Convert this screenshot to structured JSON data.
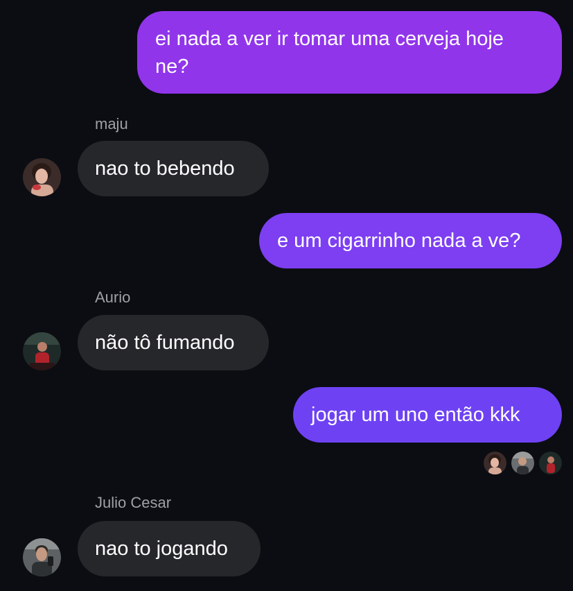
{
  "messages": [
    {
      "direction": "sent",
      "text": "ei nada a ver ir tomar uma cerveja hoje ne?",
      "color": "#9135eb"
    },
    {
      "direction": "received",
      "sender": "maju",
      "text": "nao to bebendo",
      "avatar_icon": "user-avatar-photo"
    },
    {
      "direction": "sent",
      "text": "e um cigarrinho nada a ve?",
      "color": "#7d3ff1"
    },
    {
      "direction": "received",
      "sender": "Aurio",
      "text": "não tô fumando",
      "avatar_icon": "user-avatar-photo"
    },
    {
      "direction": "sent",
      "text": "jogar um uno então kkk",
      "color": "#6e42f3"
    },
    {
      "direction": "received",
      "sender": "Julio Cesar",
      "text": "nao to jogando",
      "avatar_icon": "user-avatar-photo"
    }
  ],
  "read_receipts": [
    "maju",
    "Julio Cesar",
    "Aurio"
  ],
  "colors": {
    "background": "#0b0d12",
    "received_bubble": "#26272b",
    "sender_name": "#9ea0a6"
  }
}
